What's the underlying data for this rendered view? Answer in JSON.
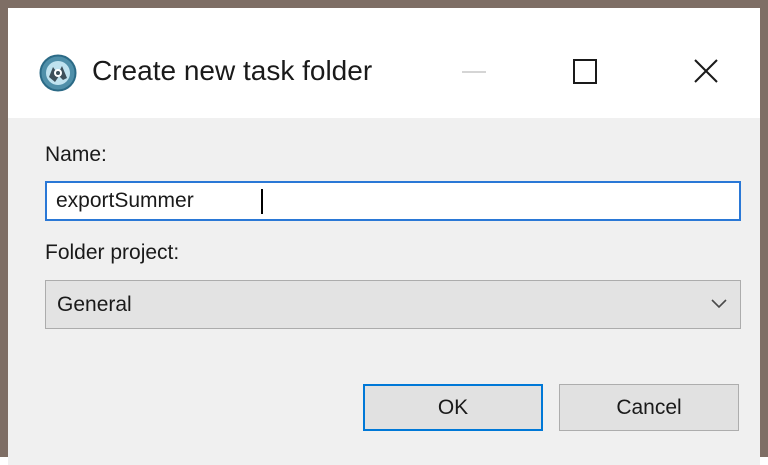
{
  "dialog": {
    "title": "Create new task folder",
    "app_icon": "app-logo-icon",
    "window_controls": {
      "minimize_icon": "minimize-icon",
      "maximize_icon": "maximize-icon",
      "close_icon": "close-icon"
    }
  },
  "form": {
    "name_label": "Name:",
    "name_value": "exportSummer",
    "project_label": "Folder project:",
    "project_value": "General",
    "project_dropdown_icon": "chevron-down-icon"
  },
  "buttons": {
    "ok_label": "OK",
    "cancel_label": "Cancel"
  },
  "colors": {
    "focus_border": "#2a78d6",
    "default_button_border": "#0078d7",
    "dialog_background": "#f0f0f0",
    "window_border": "#7e6e65"
  }
}
